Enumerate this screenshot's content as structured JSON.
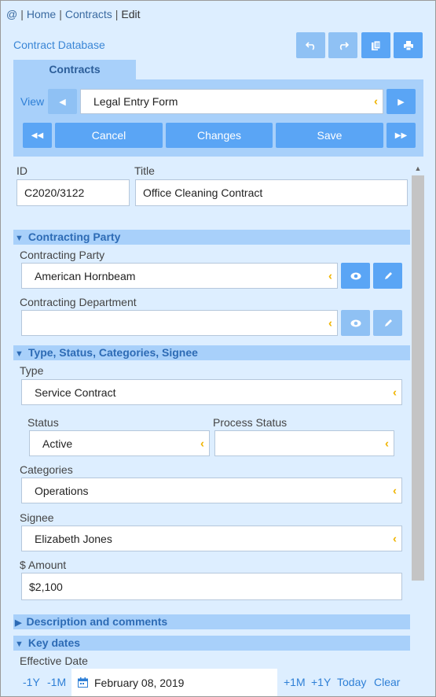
{
  "breadcrumb": {
    "at": "@",
    "home": "Home",
    "contracts": "Contracts",
    "current": "Edit"
  },
  "header": {
    "title": "Contract Database"
  },
  "toolbar": {
    "undo_icon": "undo-icon",
    "redo_icon": "redo-icon",
    "copy_icon": "copy-icon",
    "print_icon": "print-icon"
  },
  "tab": {
    "label": "Contracts"
  },
  "view": {
    "label": "View",
    "selected": "Legal Entry Form"
  },
  "actions": {
    "cancel": "Cancel",
    "changes": "Changes",
    "save": "Save"
  },
  "form": {
    "id_label": "ID",
    "id_value": "C2020/3122",
    "title_label": "Title",
    "title_value": "Office Cleaning Contract"
  },
  "sections": {
    "contracting_party": "Contracting Party",
    "type_status": "Type, Status, Categories, Signee",
    "description": "Description and comments",
    "key_dates": "Key dates"
  },
  "contracting": {
    "party_label": "Contracting Party",
    "party_value": "American Hornbeam",
    "department_label": "Contracting Department",
    "department_value": ""
  },
  "type_status": {
    "type_label": "Type",
    "type_value": "Service Contract",
    "status_label": "Status",
    "status_value": "Active",
    "process_label": "Process Status",
    "process_value": "",
    "categories_label": "Categories",
    "categories_value": "Operations",
    "signee_label": "Signee",
    "signee_value": "Elizabeth Jones",
    "amount_label": "$ Amount",
    "amount_value": "$2,100"
  },
  "key_dates": {
    "effective_label": "Effective Date",
    "minus_year": "-1Y",
    "minus_month": "-1M",
    "date_value": "February 08, 2019",
    "plus_month": "+1M",
    "plus_year": "+1Y",
    "today": "Today",
    "clear": "Clear"
  },
  "colors": {
    "accent": "#5aa5f5",
    "panel": "#a8d0fa",
    "background": "#ddeeff",
    "chevron": "#f0b400"
  }
}
